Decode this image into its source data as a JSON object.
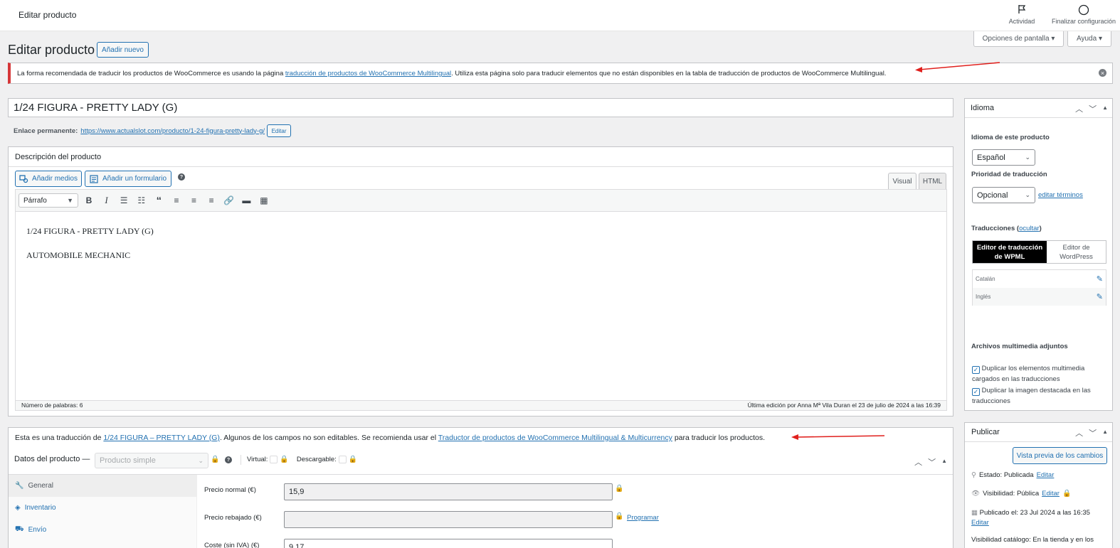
{
  "topbar": {
    "title": "Editar producto",
    "activity_label": "Actividad",
    "finish_setup_label": "Finalizar configuración"
  },
  "screen_options": {
    "label": "Opciones de pantalla ▾",
    "help_label": "Ayuda ▾"
  },
  "page": {
    "heading": "Editar producto",
    "add_new_label": "Añadir nuevo"
  },
  "notice": {
    "text_before": "La forma recomendada de traducir los productos de WooCommerce es usando la página ",
    "link": "traducción de productos de WooCommerce Multilingual",
    "text_after": ". Utiliza esta página solo para traducir elementos que no están disponibles en la tabla de traducción de productos de WooCommerce Multilingual."
  },
  "product": {
    "title": "1/24 FIGURA - PRETTY LADY (G)",
    "permalink_label": "Enlace permanente:",
    "permalink_url": "https://www.actualslot.com/producto/1-24-figura-pretty-lady-g/",
    "permalink_edit": "Editar"
  },
  "description": {
    "box_title": "Descripción del producto",
    "add_media": "Añadir medios",
    "add_form": "Añadir un formulario",
    "help_icon": "?",
    "tab_visual": "Visual",
    "tab_html": "HTML",
    "format_select": "Párrafo",
    "content_line1": "1/24 FIGURA - PRETTY LADY (G)",
    "content_line2": "AUTOMOBILE MECHANIC",
    "word_count": "Número de palabras: 6",
    "last_edit": "Última edición por Anna Mª Vila Duran el 23 de julio de 2024 a las 16:39"
  },
  "translation_notice": {
    "text_before": "Esta es una traducción de ",
    "link1": "1/24 FIGURA – PRETTY LADY (G)",
    "text_middle": ". Algunos de los campos no son editables. Se recomienda usar el ",
    "link2": "Traductor de productos de WooCommerce Multilingual & Multicurrency",
    "text_after": " para traducir los productos."
  },
  "product_data": {
    "label": "Datos del producto —",
    "type_select": "Producto simple",
    "virtual_label": "Virtual:",
    "downloadable_label": "Descargable:",
    "tabs": [
      {
        "label": "General"
      },
      {
        "label": "Inventario"
      },
      {
        "label": "Envío"
      }
    ],
    "regular_price_label": "Precio normal (€)",
    "regular_price_value": "15,9",
    "sale_price_label": "Precio rebajado (€)",
    "sale_price_value": "",
    "schedule_link": "Programar",
    "cost_label": "Coste (sin IVA) (€)",
    "cost_value": "9,17"
  },
  "language_box": {
    "title": "Idioma",
    "language_label": "Idioma de este producto",
    "language_value": "Español",
    "priority_label": "Prioridad de traducción",
    "priority_value": "Opcional",
    "edit_terms": "editar términos",
    "translations_label": "Traducciones",
    "hide_link": "ocultar",
    "wpml_editor": "Editor de traducción de WPML",
    "wp_editor": "Editor de WordPress",
    "languages": [
      {
        "name": "Catalán"
      },
      {
        "name": "Inglés"
      }
    ],
    "media_label": "Archivos multimedia adjuntos",
    "dup_media": "Duplicar los elementos multimedia cargados en las traducciones",
    "dup_featured": "Duplicar la imagen destacada en las traducciones"
  },
  "publish_box": {
    "title": "Publicar",
    "preview_button": "Vista previa de los cambios",
    "status_label": "Estado: Publicada",
    "status_edit": "Editar",
    "visibility_label": "Visibilidad: Pública",
    "visibility_edit": "Editar",
    "published_label": "Publicado el: 23 Jul 2024 a las 16:35",
    "published_edit": "Editar",
    "catalog_label": "Visibilidad catálogo: En la tienda y en los"
  },
  "colors": {
    "accent": "#2271b1",
    "error": "#d63638",
    "annotation_arrow": "#e0201d"
  }
}
